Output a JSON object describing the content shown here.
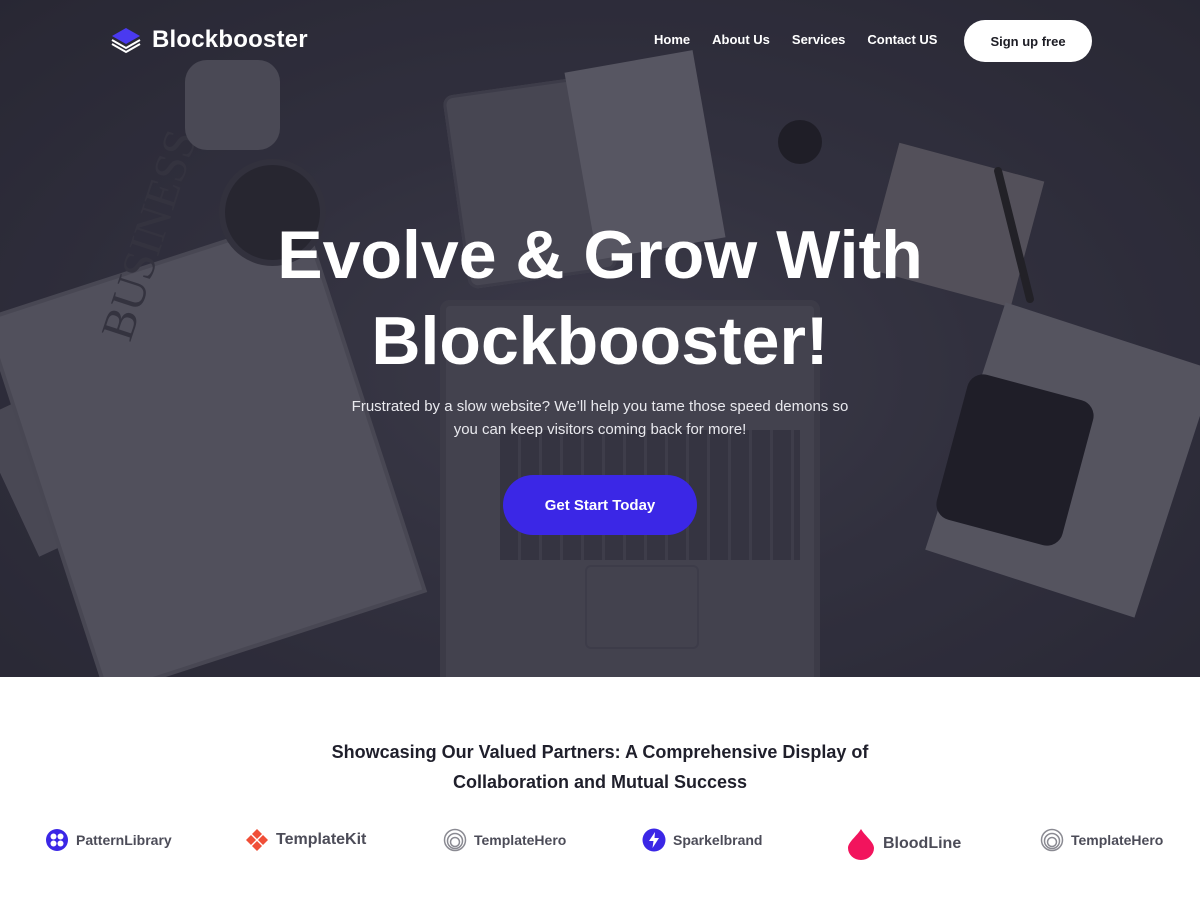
{
  "brand": {
    "name": "Blockbooster",
    "icon": "stacked-layers-logo-icon"
  },
  "nav": {
    "items": [
      "Home",
      "About Us",
      "Services",
      "Contact US"
    ],
    "signup_label": "Sign up free"
  },
  "hero": {
    "title_line1": "Evolve & Grow With",
    "title_line2": "Blockbooster!",
    "subtitle_line1": "Frustrated by a slow website? We’ll help you tame those speed demons so",
    "subtitle_line2": "you can keep visitors coming back for more!",
    "cta_label": "Get Start Today",
    "newspaper_word": "BUSINESS"
  },
  "partners": {
    "title_line1": "Showcasing Our Valued Partners: A Comprehensive Display of",
    "title_line2": "Collaboration and Mutual Success",
    "logos": [
      {
        "name": "PatternLibrary",
        "icon": "pattern-library-icon",
        "color": "#3b27e6"
      },
      {
        "name": "TemplateKit",
        "icon": "template-kit-icon",
        "color": "#f04e37"
      },
      {
        "name": "TemplateHero",
        "icon": "template-hero-icon",
        "color": "#8a8a92"
      },
      {
        "name": "Sparkelbrand",
        "icon": "sparkel-bolt-icon",
        "color": "#3b27e6"
      },
      {
        "name": "BloodLine",
        "icon": "blood-drop-icon",
        "color": "#f2145d"
      },
      {
        "name": "TemplateHero",
        "icon": "template-hero-icon",
        "color": "#8a8a92"
      }
    ]
  },
  "colors": {
    "accent": "#3b27e6",
    "heading": "#1f1f2b"
  }
}
